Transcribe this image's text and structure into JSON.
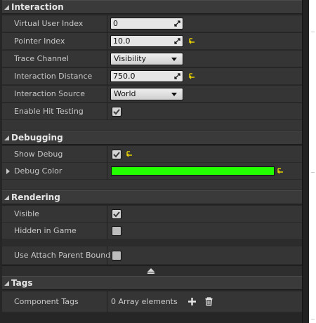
{
  "interaction": {
    "header": "Interaction",
    "virtual_user_index": {
      "label": "Virtual User Index",
      "value": "0"
    },
    "pointer_index": {
      "label": "Pointer Index",
      "value": "10.0"
    },
    "trace_channel": {
      "label": "Trace Channel",
      "value": "Visibility"
    },
    "interaction_distance": {
      "label": "Interaction Distance",
      "value": "750.0"
    },
    "interaction_source": {
      "label": "Interaction Source",
      "value": "World"
    },
    "enable_hit_testing": {
      "label": "Enable Hit Testing",
      "checked": true
    }
  },
  "debugging": {
    "header": "Debugging",
    "show_debug": {
      "label": "Show Debug",
      "checked": true
    },
    "debug_color": {
      "label": "Debug Color",
      "color": "#23ff00"
    }
  },
  "rendering": {
    "header": "Rendering",
    "visible": {
      "label": "Visible",
      "checked": true
    },
    "hidden_in_game": {
      "label": "Hidden in Game",
      "checked": false
    },
    "use_attach_parent_bound": {
      "label": "Use Attach Parent Bound",
      "checked": false
    }
  },
  "tags": {
    "header": "Tags",
    "component_tags": {
      "label": "Component Tags",
      "value": "0 Array elements"
    }
  },
  "colors": {
    "panel_bg": "#262626",
    "row_bg": "#353535",
    "header_bg": "#3a3a3a",
    "reset_arrow": "#e6d000",
    "debug_green": "#23ff00"
  },
  "icons": [
    "collapse-triangle-icon",
    "drag-arrows-icon",
    "dropdown-arrow-icon",
    "checkmark-icon",
    "reset-to-default-icon",
    "expand-arrow-icon",
    "show-advanced-icon",
    "add-icon",
    "trash-icon"
  ]
}
